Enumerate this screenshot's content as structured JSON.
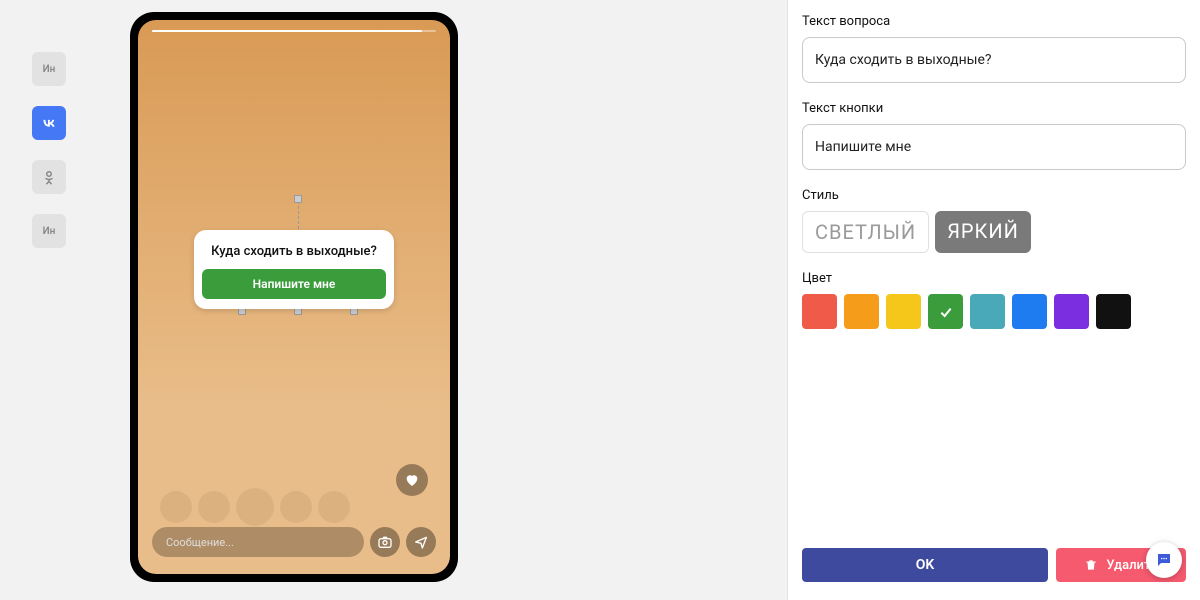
{
  "sidebar": {
    "items": [
      {
        "label": "Ин"
      },
      {
        "label": "vk"
      },
      {
        "label": "ok"
      },
      {
        "label": "Ин"
      }
    ],
    "activeIndex": 1
  },
  "phone": {
    "question": "Куда сходить в выходные?",
    "button": "Напишите мне",
    "messagePlaceholder": "Сообщение..."
  },
  "panel": {
    "questionLabel": "Текст вопроса",
    "questionValue": "Куда сходить в выходные?",
    "buttonLabel": "Текст кнопки",
    "buttonValue": "Напишите мне",
    "styleLabel": "Стиль",
    "styleOptions": {
      "light": "СВЕТЛЫЙ",
      "dark": "ЯРКИЙ"
    },
    "styleSelected": "dark",
    "colorLabel": "Цвет",
    "colors": [
      "#f05a48",
      "#f59c1a",
      "#f5c71a",
      "#3b9c3b",
      "#4aa9b8",
      "#1e7cf0",
      "#7a2ee0",
      "#111111"
    ],
    "selectedColorIndex": 3,
    "okLabel": "OK",
    "deleteLabel": "Удалить"
  }
}
